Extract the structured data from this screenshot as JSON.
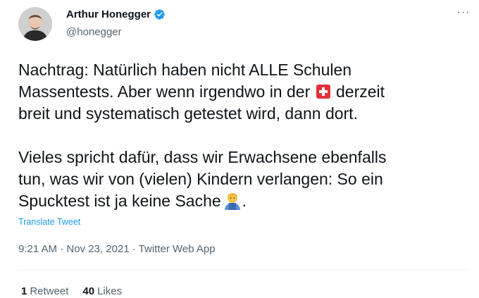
{
  "author": {
    "name": "Arthur Honegger",
    "handle": "@honegger"
  },
  "icons": {
    "verified": "verified-badge-icon",
    "more": "more-icon",
    "flag": "swiss-flag-emoji",
    "person": "person-emoji"
  },
  "colors": {
    "accent": "#1d9bf0",
    "flag_red": "#e5303a"
  },
  "tweet": {
    "p1_line1": "Nachtrag: Natürlich haben nicht ALLE Schulen",
    "p1_line2a": "Massentests. Aber wenn irgendwo in der",
    "p1_line2b": "derzeit",
    "p1_line3": "breit und systematisch getestet wird, dann dort.",
    "p2_line1": "Vieles spricht dafür, dass wir Erwachsene ebenfalls",
    "p2_line2": "tun, was wir von (vielen) Kindern verlangen: So ein",
    "p2_line3a": "Spucktest ist ja keine Sache",
    "p2_line3b": "."
  },
  "translate_label": "Translate Tweet",
  "meta": "9:21 AM · Nov 23, 2021 · Twitter Web App",
  "stats": {
    "retweets_count": "1",
    "retweets_label": "Retweet",
    "likes_count": "40",
    "likes_label": "Likes"
  }
}
